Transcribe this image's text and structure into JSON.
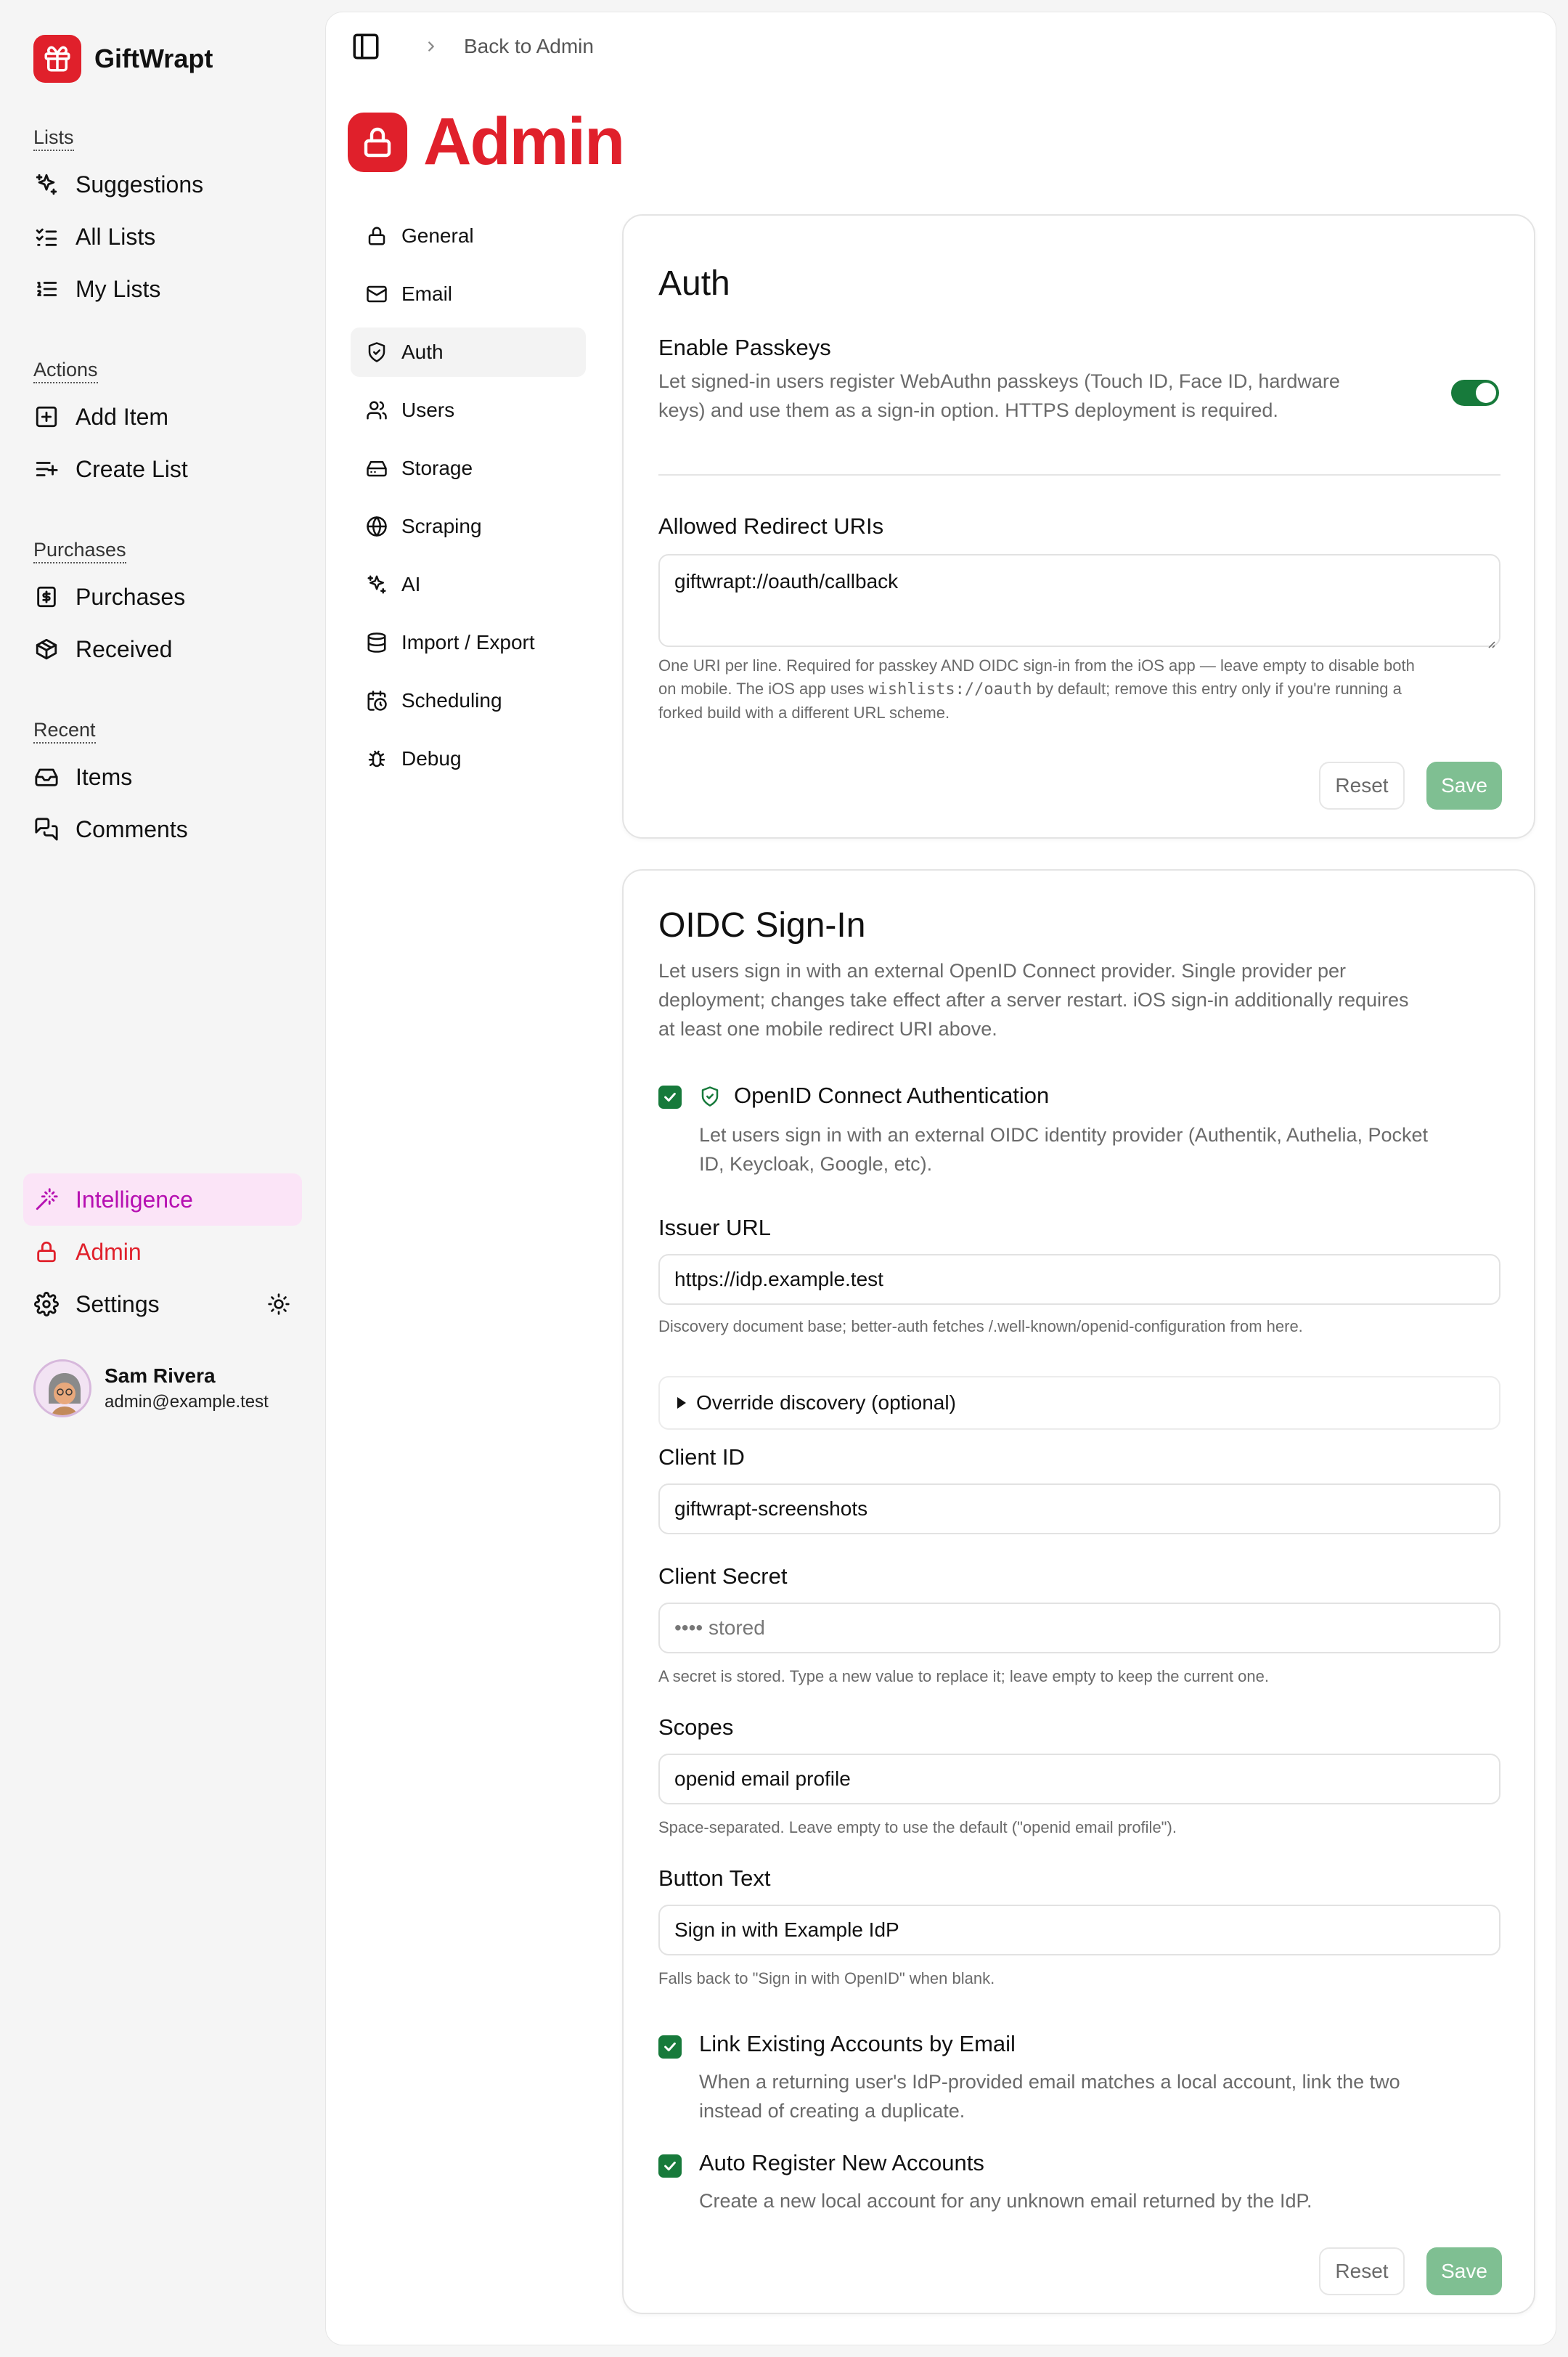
{
  "brand": {
    "name": "GiftWrapt"
  },
  "sidebar": {
    "groups": [
      {
        "title": "Lists",
        "items": [
          {
            "label": "Suggestions",
            "icon": "sparkles-icon"
          },
          {
            "label": "All Lists",
            "icon": "list-checks-icon"
          },
          {
            "label": "My Lists",
            "icon": "list-ordered-icon"
          }
        ]
      },
      {
        "title": "Actions",
        "items": [
          {
            "label": "Add Item",
            "icon": "square-plus-icon"
          },
          {
            "label": "Create List",
            "icon": "list-plus-icon"
          }
        ]
      },
      {
        "title": "Purchases",
        "items": [
          {
            "label": "Purchases",
            "icon": "receipt-icon"
          },
          {
            "label": "Received",
            "icon": "package-icon"
          }
        ]
      },
      {
        "title": "Recent",
        "items": [
          {
            "label": "Items",
            "icon": "inbox-icon"
          },
          {
            "label": "Comments",
            "icon": "messages-icon"
          }
        ]
      }
    ],
    "bottom": {
      "intelligence": "Intelligence",
      "admin": "Admin",
      "settings": "Settings"
    },
    "user": {
      "name": "Sam Rivera",
      "email": "admin@example.test"
    }
  },
  "topbar": {
    "back": "Back to Admin"
  },
  "page": {
    "title": "Admin"
  },
  "admin_nav": [
    {
      "label": "General",
      "icon": "lock-icon",
      "active": false
    },
    {
      "label": "Email",
      "icon": "mail-icon",
      "active": false
    },
    {
      "label": "Auth",
      "icon": "shield-icon",
      "active": true
    },
    {
      "label": "Users",
      "icon": "users-icon",
      "active": false
    },
    {
      "label": "Storage",
      "icon": "hard-drive-icon",
      "active": false
    },
    {
      "label": "Scraping",
      "icon": "globe-icon",
      "active": false
    },
    {
      "label": "AI",
      "icon": "sparkles-icon",
      "active": false
    },
    {
      "label": "Import / Export",
      "icon": "database-icon",
      "active": false
    },
    {
      "label": "Scheduling",
      "icon": "calendar-clock-icon",
      "active": false
    },
    {
      "label": "Debug",
      "icon": "bug-icon",
      "active": false
    }
  ],
  "auth": {
    "title": "Auth",
    "passkeys": {
      "label": "Enable Passkeys",
      "desc1": "Let signed-in users register WebAuthn passkeys (Touch ID, Face ID, hardware",
      "desc2": "keys) and use them as a sign-in option. HTTPS deployment is required.",
      "enabled": true
    },
    "redirect": {
      "label": "Allowed Redirect URIs",
      "value": "giftwrapt://oauth/callback",
      "hint1": "One URI per line. Required for passkey AND OIDC sign-in from the iOS app — leave empty to disable both",
      "hint2a": "on mobile. The iOS app uses ",
      "hint2code": "wishlists://oauth",
      "hint2b": " by default; remove this entry only if you're running a",
      "hint3": "forked build with a different URL scheme."
    },
    "reset": "Reset",
    "save": "Save"
  },
  "oidc": {
    "title": "OIDC Sign-In",
    "desc1": "Let users sign in with an external OpenID Connect provider. Single provider per",
    "desc2": "deployment; changes take effect after a server restart. iOS sign-in additionally requires",
    "desc3": "at least one mobile redirect URI above.",
    "enable": {
      "label": "OpenID Connect Authentication",
      "desc1": "Let users sign in with an external OIDC identity provider (Authentik, Authelia, Pocket",
      "desc2": "ID, Keycloak, Google, etc).",
      "checked": true
    },
    "issuer": {
      "label": "Issuer URL",
      "value": "https://idp.example.test",
      "hint": "Discovery document base; better-auth fetches /.well-known/openid-configuration from here."
    },
    "override": "Override discovery (optional)",
    "client_id": {
      "label": "Client ID",
      "value": "giftwrapt-screenshots"
    },
    "client_secret": {
      "label": "Client Secret",
      "placeholder": "•••• stored",
      "hint": "A secret is stored. Type a new value to replace it; leave empty to keep the current one."
    },
    "scopes": {
      "label": "Scopes",
      "value": "openid email profile",
      "hint": "Space-separated. Leave empty to use the default (\"openid email profile\")."
    },
    "button_text": {
      "label": "Button Text",
      "value": "Sign in with Example IdP",
      "hint": "Falls back to \"Sign in with OpenID\" when blank."
    },
    "link_accounts": {
      "label": "Link Existing Accounts by Email",
      "desc1": "When a returning user's IdP-provided email matches a local account, link the two",
      "desc2": "instead of creating a duplicate.",
      "checked": true
    },
    "auto_register": {
      "label": "Auto Register New Accounts",
      "desc": "Create a new local account for any unknown email returned by the IdP.",
      "checked": true
    },
    "reset": "Reset",
    "save": "Save"
  },
  "colors": {
    "brand": "#e0202b",
    "success": "#177a3b",
    "save_disabled": "#7fbf92",
    "intelligence": "#b60fb1",
    "intelligence_bg": "#fbe4f7"
  }
}
